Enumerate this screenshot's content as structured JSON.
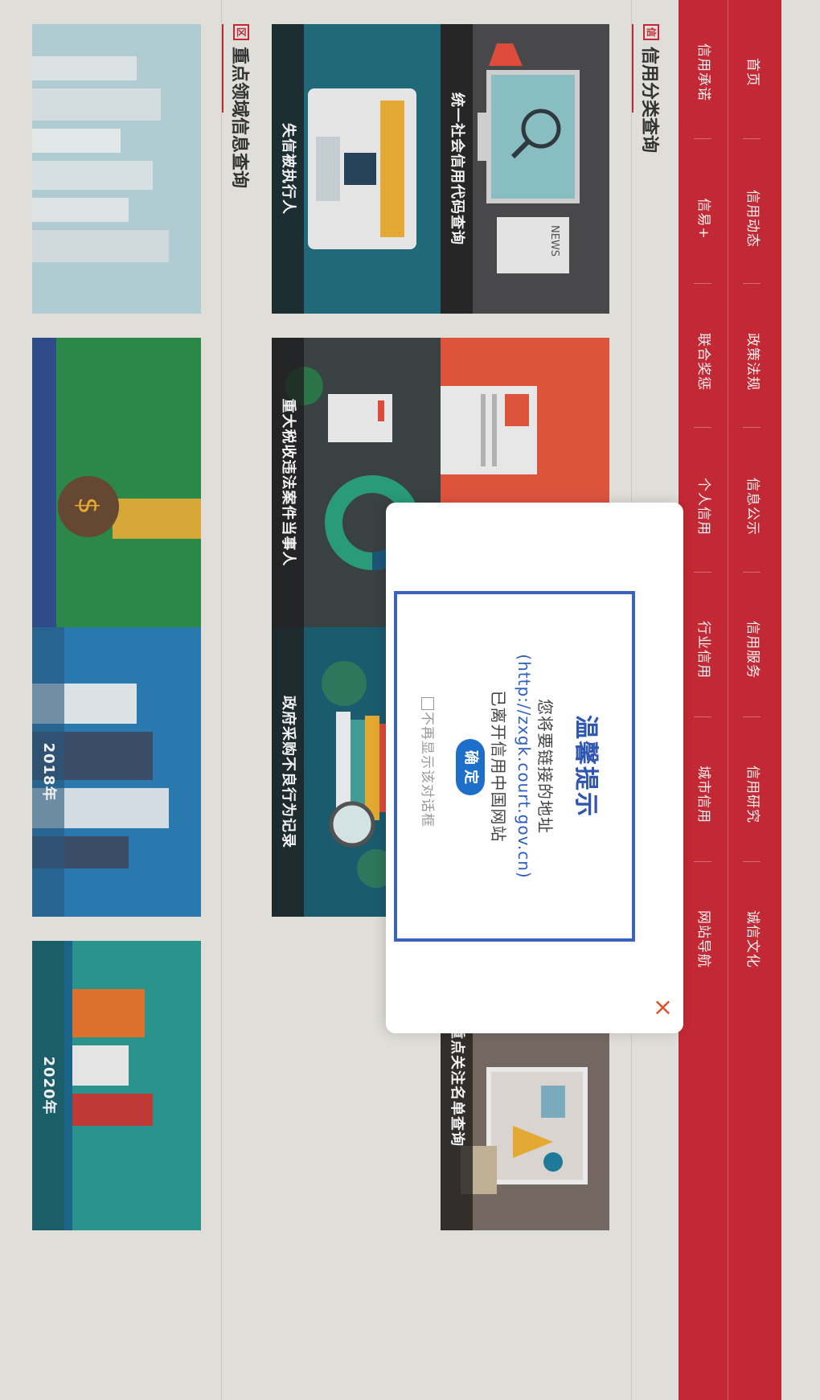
{
  "nav": {
    "row1": [
      "首页",
      "信用动态",
      "政策法规",
      "信息公示",
      "信用服务",
      "信用研究",
      "诚信文化"
    ],
    "row2": [
      "信用承诺",
      "信易+",
      "联合奖惩",
      "个人信用",
      "行业信用",
      "城市信用",
      "网站导航"
    ]
  },
  "sections": {
    "credit": {
      "icon": "信",
      "title": "信用分类查询",
      "tiles": [
        "统一社会信用代码查询",
        "",
        "重点关注名单查询",
        "失信被执行人",
        "重大税收违法案件当事人",
        "政府采购不良行为记录"
      ]
    },
    "key": {
      "icon": "区",
      "title": "重点领域信息查询",
      "tile_labels": [
        "2018年",
        "2020年"
      ]
    }
  },
  "modal": {
    "close": "×",
    "title": "温馨提示",
    "line1": "您将要链接的地址",
    "url": "(http://zxgk.court.gov.cn)",
    "line2": "已离开信用中国网站",
    "confirm": "确 定",
    "dont_show": "不再显示该对话框"
  },
  "colors": {
    "nav": "#cc2a36",
    "modal_border": "#3a63bd",
    "button": "#1d6fc9",
    "close": "#e0522b"
  }
}
